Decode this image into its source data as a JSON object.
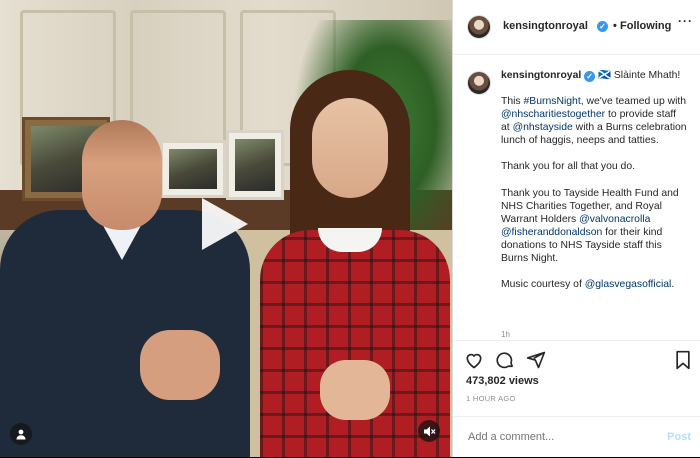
{
  "post": {
    "username": "kensingtonroyal",
    "verified_icon": "verified-badge-icon",
    "separator": "•",
    "follow_label": "Following",
    "more_label": "···",
    "caption_user": "kensingtonroyal",
    "caption_heading": "🏴󠁧󠁢󠁳󠁣󠁴󠁿 Slàinte Mhath!",
    "caption_p1_a": "This ",
    "caption_p1_tag1": "#BurnsNight",
    "caption_p1_b": ", we've teamed up with ",
    "caption_p1_tag2": "@nhscharitiestogether",
    "caption_p1_c": " to provide staff at ",
    "caption_p1_tag3": "@nhstayside",
    "caption_p1_d": " with a Burns celebration lunch of haggis, neeps and tatties.",
    "caption_p2": "Thank you for all that you do.",
    "caption_p3_a": "Thank you to Tayside Health Fund and NHS Charities Together, and Royal Warrant Holders ",
    "caption_p3_tag1": "@valvonacrolla",
    "caption_p3_tag2": "@fisheranddonaldson",
    "caption_p3_b": " for their kind donations to NHS Tayside staff this Burns Night.",
    "caption_p4_a": "Music courtesy of ",
    "caption_p4_tag": "@glasvegasofficial",
    "caption_p4_b": ".",
    "caption_time": "1h",
    "views": "473,802 views",
    "time_ago": "1 HOUR AGO",
    "comment_placeholder": "Add a comment...",
    "post_label": "Post"
  },
  "icons": {
    "like": "heart-icon",
    "comment": "comment-icon",
    "share": "share-icon",
    "save": "bookmark-icon",
    "play": "play-icon",
    "tag": "user-tag-icon",
    "mute": "speaker-muted-icon"
  },
  "colors": {
    "link": "#00376b",
    "verified": "#3897f0",
    "post_disabled": "#b2dffc",
    "muted_text": "#8e8e8e"
  }
}
